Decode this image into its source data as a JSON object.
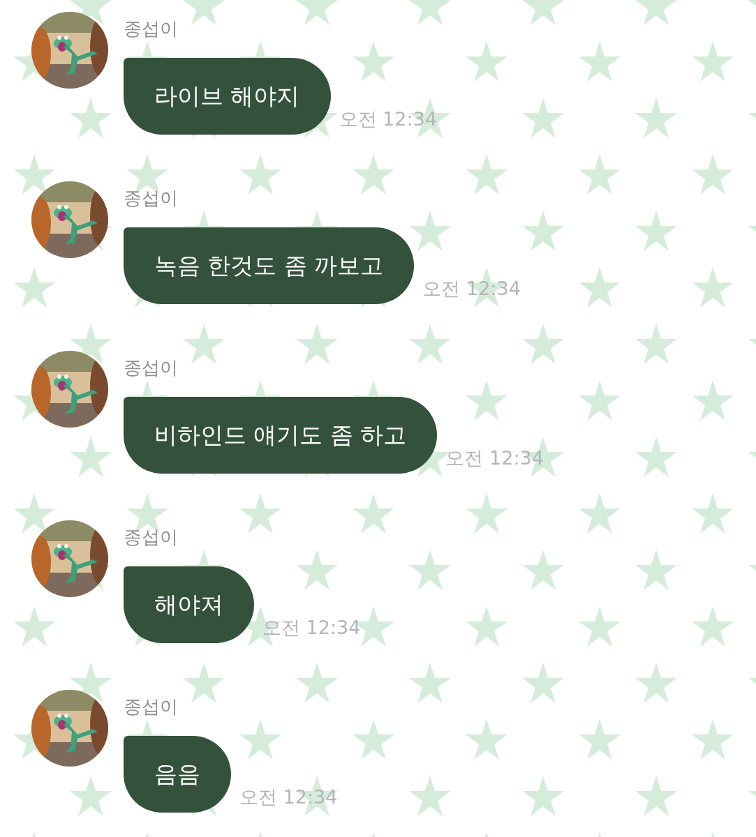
{
  "messages": [
    {
      "sender": "종섭이",
      "text": "라이브 해야지",
      "time": "오전 12:34"
    },
    {
      "sender": "종섭이",
      "text": "녹음 한것도 좀 까보고",
      "time": "오전 12:34"
    },
    {
      "sender": "종섭이",
      "text": "비하인드 얘기도 좀 하고",
      "time": "오전 12:34"
    },
    {
      "sender": "종섭이",
      "text": "해야져",
      "time": "오전 12:34"
    },
    {
      "sender": "종섭이",
      "text": "음음",
      "time": "오전 12:34"
    }
  ]
}
